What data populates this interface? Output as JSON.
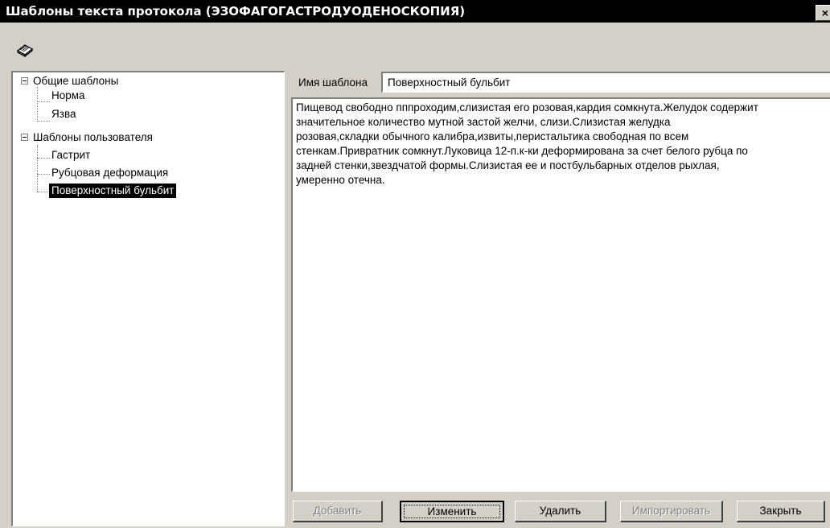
{
  "window": {
    "title": "Шаблоны текста протокола (ЭЗОФАГОГАСТРОДУОДЕНОСКОПИЯ)",
    "close_glyph": "×"
  },
  "toolbar": {
    "icon": "book-icon"
  },
  "tree": {
    "groups": [
      {
        "label": "Общие шаблоны",
        "expanded": true,
        "items": [
          "Норма",
          "Язва"
        ]
      },
      {
        "label": "Шаблоны пользователя",
        "expanded": true,
        "items": [
          "Гастрит",
          "Рубцовая деформация",
          "Поверхностный бульбит"
        ]
      }
    ],
    "selected": "Поверхностный бульбит"
  },
  "form": {
    "name_label": "Имя шаблона",
    "name_value": "Поверхностный бульбит",
    "text": "Пищевод свободно пппроходим,слизистая его розовая,кардия сомкнута.Желудок содержит\nзначительное количество мутной застой желчи, слизи.Слизистая желудка\nрозовая,складки обычного калибра,извиты,перистальтика свободная по всем\nстенкам.Привратник сомкнут.Луковица 12-п.к-ки деформирована за счет белого рубца по\nзадней стенки,звездчатой формы.Слизистая ее и постбульбарных отделов рыхлая,\nумеренно отечна."
  },
  "buttons": {
    "add": "Добавить",
    "edit": "Изменить",
    "delete": "Удалить",
    "import": "Импортировать",
    "close": "Закрыть"
  }
}
